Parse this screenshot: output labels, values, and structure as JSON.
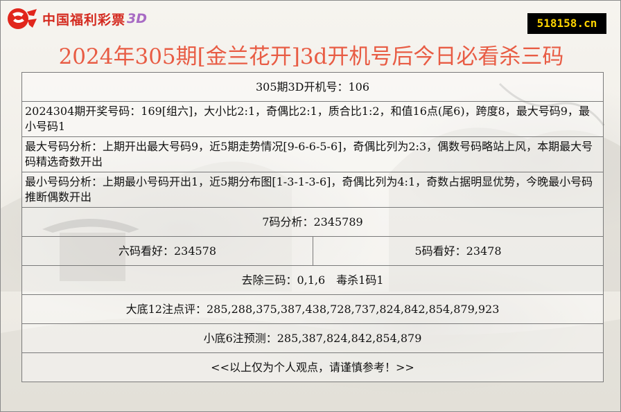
{
  "brand": {
    "name": "中国福利彩票",
    "product": "3D"
  },
  "site_badge": "518158.cn",
  "headline": "2024年305期[金兰花开]3d开机号后今日必看杀三码",
  "rows": {
    "kaiji": "305期3D开机号：106",
    "kaijiang": "2024304期开奖号码：169[组六]，大小比2:1，奇偶比2:1，质合比1:2，和值16点(尾6)，跨度8，最大号码9，最小号码1",
    "max_analysis": "最大号码分析：上期开出最大号码9，近5期走势情况[9-6-6-5-6]，奇偶比列为2:3，偶数号码略站上风，本期最大号码精选奇数开出",
    "min_analysis": "最小号码分析：上期最小号码开出1，近5期分布图[1-3-1-3-6]，奇偶比列为4:1，奇数占据明显优势，今晚最小号码推断偶数开出",
    "seven_code": "7码分析：2345789",
    "six_code": "六码看好：234578",
    "five_code": "5码看好：23478",
    "kill": "去除三码：0,1,6　毒杀1码1",
    "big12": "大底12注点评：285,288,375,387,438,728,737,824,842,854,879,923",
    "small6": "小底6注预测：285,387,824,842,854,879",
    "disclaimer": "<<以上仅为个人观点，请谨慎参考！>>"
  },
  "colors": {
    "headline": "#e85c44",
    "brand_red": "#d42a1f",
    "brand_3d": "#a86bc4",
    "badge_bg": "#000000",
    "badge_text": "#ffd400"
  }
}
